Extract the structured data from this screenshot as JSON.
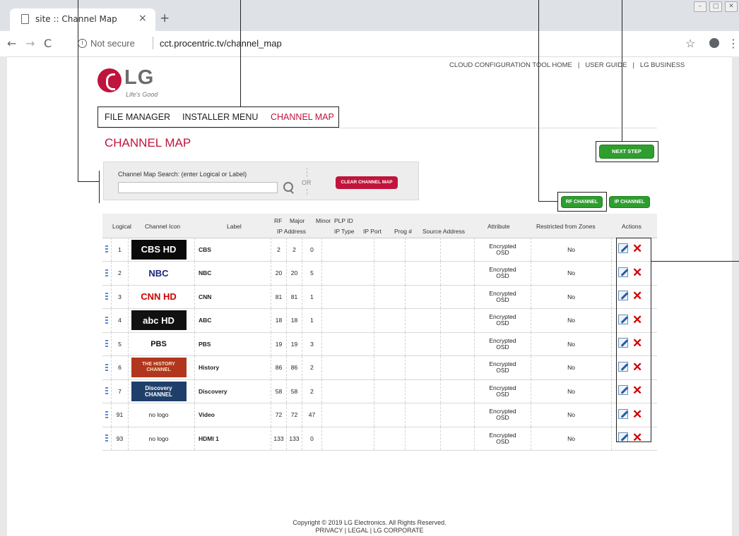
{
  "browser": {
    "tab_title": "site :: Channel Map",
    "tab_close": "×",
    "new_tab": "+",
    "nav_back": "←",
    "nav_forward": "→",
    "nav_reload": "C",
    "security_label": "Not secure",
    "url": "cct.procentric.tv/channel_map",
    "bookmark": "☆",
    "menu": "⋮",
    "window_controls": [
      "–",
      "□",
      "✕"
    ]
  },
  "header": {
    "links": [
      "CLOUD CONFIGURATION TOOL HOME",
      "USER GUIDE",
      "LG BUSINESS"
    ],
    "separator": "|",
    "logo_text": "LG",
    "logo_tagline": "Life's Good"
  },
  "nav": {
    "items": [
      "FILE MANAGER",
      "INSTALLER MENU",
      "CHANNEL MAP"
    ],
    "active": "CHANNEL MAP"
  },
  "page_title": "CHANNEL MAP",
  "buttons": {
    "next_step": "NEXT STEP",
    "clear_channel_map": "CLEAR CHANNEL MAP",
    "rf_channel": "RF CHANNEL",
    "ip_channel": "IP CHANNEL"
  },
  "search": {
    "label": "Channel Map Search: (enter Logical or Label)",
    "value": "",
    "placeholder": "",
    "or": "OR"
  },
  "table": {
    "headers": {
      "logical": "Logical",
      "channel_icon": "Channel Icon",
      "label": "Label",
      "rf": "RF",
      "major": "Major",
      "minor": "Minor",
      "plp_id": "PLP ID",
      "ip_address": "IP Address",
      "ip_type": "IP Type",
      "ip_port": "IP Port",
      "prog": "Prog #",
      "source_address": "Source Address",
      "attribute": "Attribute",
      "restricted": "Restricted from Zones",
      "actions": "Actions"
    },
    "rows": [
      {
        "logical": "1",
        "icon": "CBS HD",
        "label": "CBS",
        "rf": "2",
        "major": "2",
        "minor": "0",
        "attr1": "Encrypted",
        "attr2": "OSD",
        "restricted": "No"
      },
      {
        "logical": "2",
        "icon": "NBC",
        "label": "NBC",
        "rf": "20",
        "major": "20",
        "minor": "5",
        "attr1": "Encrypted",
        "attr2": "OSD",
        "restricted": "No"
      },
      {
        "logical": "3",
        "icon": "CNN HD",
        "label": "CNN",
        "rf": "81",
        "major": "81",
        "minor": "1",
        "attr1": "Encrypted",
        "attr2": "OSD",
        "restricted": "No"
      },
      {
        "logical": "4",
        "icon": "abc HD",
        "label": "ABC",
        "rf": "18",
        "major": "18",
        "minor": "1",
        "attr1": "Encrypted",
        "attr2": "OSD",
        "restricted": "No"
      },
      {
        "logical": "5",
        "icon": "PBS",
        "label": "PBS",
        "rf": "19",
        "major": "19",
        "minor": "3",
        "attr1": "Encrypted",
        "attr2": "OSD",
        "restricted": "No"
      },
      {
        "logical": "6",
        "icon": "THE HISTORY CHANNEL",
        "label": "History",
        "rf": "86",
        "major": "86",
        "minor": "2",
        "attr1": "Encrypted",
        "attr2": "OSD",
        "restricted": "No"
      },
      {
        "logical": "7",
        "icon": "Discovery CHANNEL",
        "label": "Discovery",
        "rf": "58",
        "major": "58",
        "minor": "2",
        "attr1": "Encrypted",
        "attr2": "OSD",
        "restricted": "No"
      },
      {
        "logical": "91",
        "icon": "no logo",
        "label": "Video",
        "rf": "72",
        "major": "72",
        "minor": "47",
        "attr1": "Encrypted",
        "attr2": "OSD",
        "restricted": "No"
      },
      {
        "logical": "93",
        "icon": "no logo",
        "label": "HDMI 1",
        "rf": "133",
        "major": "133",
        "minor": "0",
        "attr1": "Encrypted",
        "attr2": "OSD",
        "restricted": "No"
      }
    ]
  },
  "icons": {
    "edit": "pencil-edit-icon",
    "delete": "red-x-delete-icon",
    "drag": "drag-handle-icon"
  },
  "colors": {
    "brand": "#c0143c",
    "button_green": "#2e9e2e"
  },
  "footer": {
    "copyright": "Copyright © 2019 LG Electronics. All Rights Reserved.",
    "links": [
      "PRIVACY",
      "LEGAL",
      "LG CORPORATE"
    ],
    "separator": "|"
  }
}
